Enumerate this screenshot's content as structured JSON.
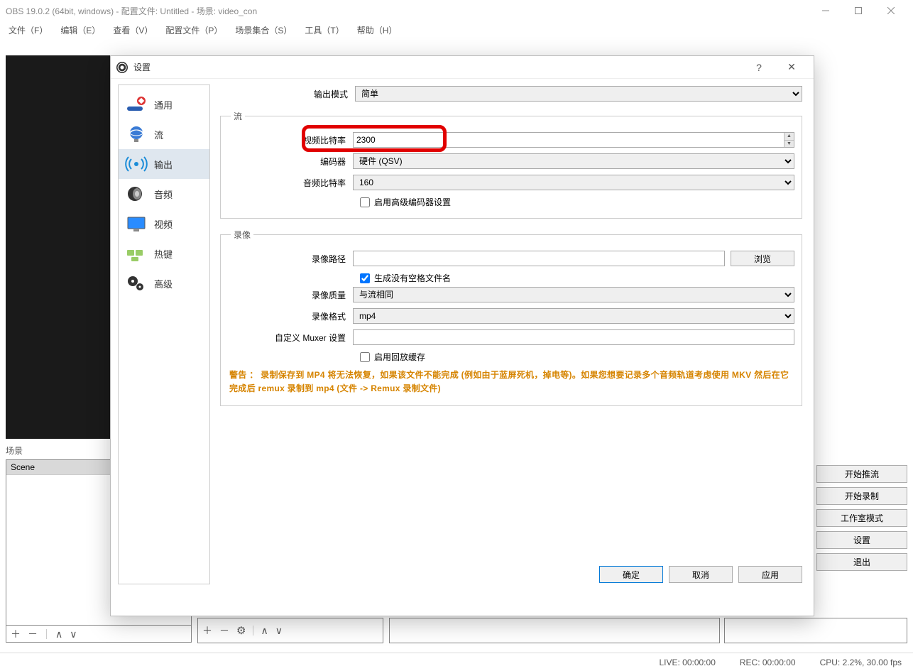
{
  "window": {
    "title": "OBS 19.0.2 (64bit, windows) - 配置文件: Untitled - 场景: video_con"
  },
  "menu": {
    "file": "文件（F）",
    "edit": "编辑（E）",
    "view": "查看（V）",
    "profile": "配置文件（P）",
    "scene_collection": "场景集合（S）",
    "tools": "工具（T）",
    "help": "帮助（H）"
  },
  "scenes": {
    "header": "场景",
    "items": [
      "Scene"
    ]
  },
  "side_buttons": {
    "start_stream": "开始推流",
    "start_record": "开始录制",
    "studio_mode": "工作室模式",
    "settings": "设置",
    "exit": "退出"
  },
  "statusbar": {
    "live": "LIVE: 00:00:00",
    "rec": "REC: 00:00:00",
    "cpu": "CPU: 2.2%, 30.00 fps"
  },
  "dialog": {
    "title": "设置",
    "sidebar": {
      "general": "通用",
      "stream": "流",
      "output": "输出",
      "audio": "音频",
      "video": "视频",
      "hotkeys": "热键",
      "advanced": "高级"
    },
    "output_mode_label": "输出模式",
    "output_mode_value": "简单",
    "stream_group": "流",
    "video_bitrate_label": "视频比特率",
    "video_bitrate_value": "2300",
    "encoder_label": "编码器",
    "encoder_value": "硬件 (QSV)",
    "audio_bitrate_label": "音频比特率",
    "audio_bitrate_value": "160",
    "adv_encoder_checkbox": "启用高级编码器设置",
    "record_group": "录像",
    "record_path_label": "录像路径",
    "record_path_value": "",
    "browse": "浏览",
    "nospace_checkbox": "生成没有空格文件名",
    "record_quality_label": "录像质量",
    "record_quality_value": "与流相同",
    "record_format_label": "录像格式",
    "record_format_value": "mp4",
    "muxer_label": "自定义 Muxer 设置",
    "muxer_value": "",
    "replay_buffer_checkbox": "启用回放缓存",
    "warning": "警告 ： 录制保存到 MP4 将无法恢复，如果该文件不能完成 (例如由于蓝屏死机，掉电等)。如果您想要记录多个音频轨道考虑使用 MKV 然后在它完成后 remux 录制到 mp4 (文件 -> Remux 录制文件)",
    "ok": "确定",
    "cancel": "取消",
    "apply": "应用"
  }
}
